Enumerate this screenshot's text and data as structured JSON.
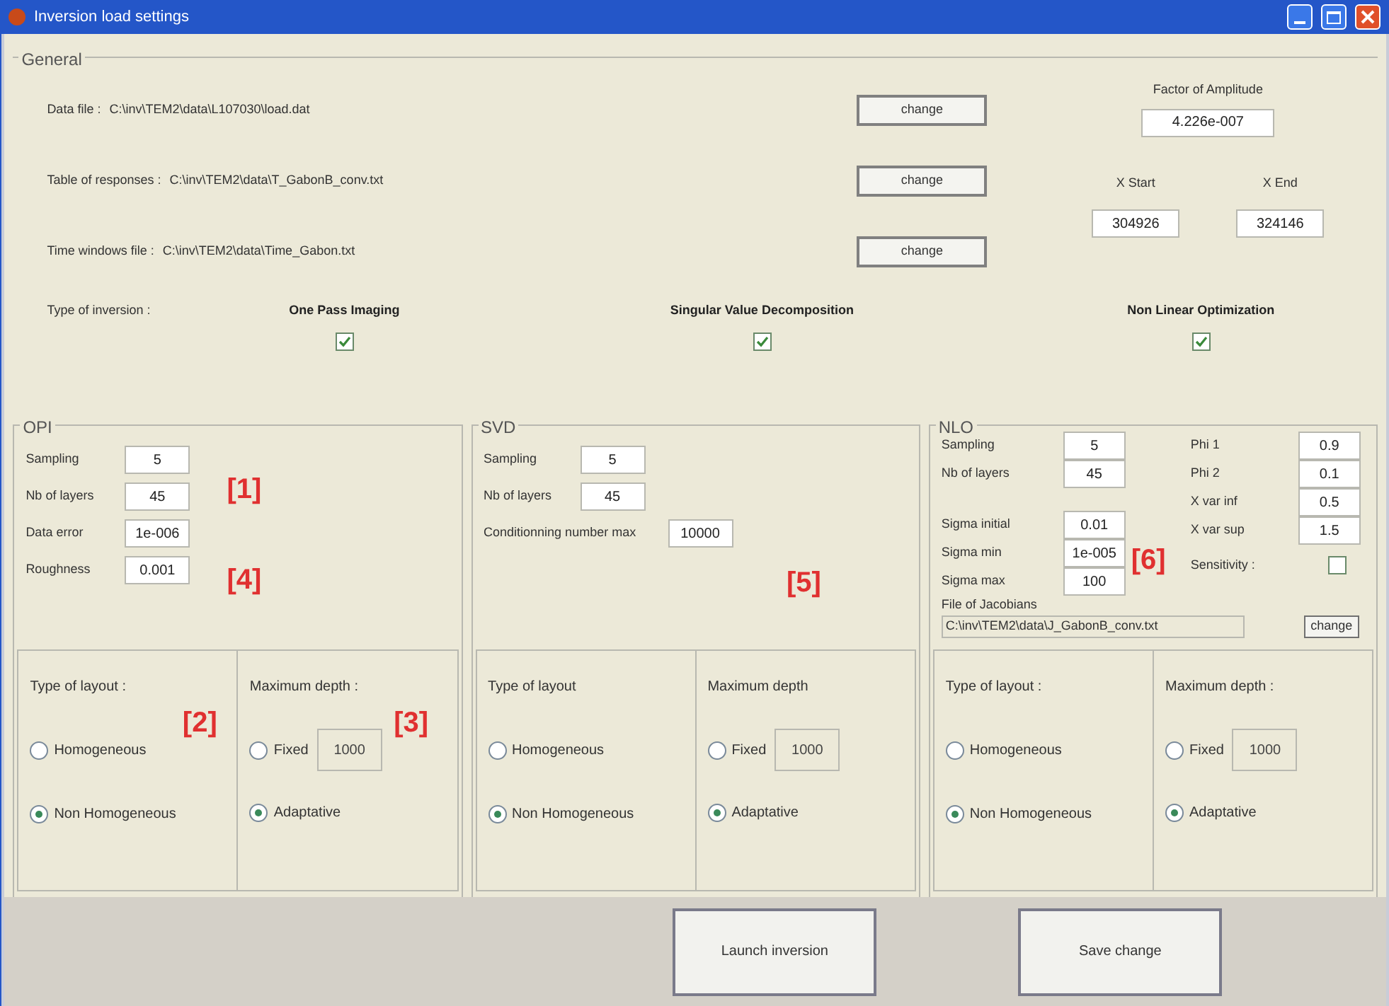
{
  "window": {
    "title": "Inversion load settings"
  },
  "general": {
    "legend": "General",
    "files": [
      {
        "label": "Data file :",
        "path": "C:\\inv\\TEM2\\data\\L107030\\load.dat",
        "button": "change"
      },
      {
        "label": "Table of responses :",
        "path": "C:\\inv\\TEM2\\data\\T_GabonB_conv.txt",
        "button": "change"
      },
      {
        "label": "Time windows file :",
        "path": "C:\\inv\\TEM2\\data\\Time_Gabon.txt",
        "button": "change"
      }
    ],
    "amplitude": {
      "label": "Factor of Amplitude",
      "value": "4.226e-007"
    },
    "x_start": {
      "label": "X Start",
      "value": "304926"
    },
    "x_end": {
      "label": "X End",
      "value": "324146"
    },
    "inversion_type": {
      "label": "Type of inversion :",
      "options": [
        {
          "label": "One Pass Imaging",
          "checked": true
        },
        {
          "label": "Singular Value Decomposition",
          "checked": true
        },
        {
          "label": "Non Linear Optimization",
          "checked": true
        }
      ]
    }
  },
  "panels": [
    {
      "kind": "opi",
      "legend": "OPI",
      "fields": [
        {
          "label": "Sampling",
          "value": "5"
        },
        {
          "label": "Nb of layers",
          "value": "45"
        },
        {
          "label": "Data error",
          "value": "1e-006"
        },
        {
          "label": "Roughness",
          "value": "0.001"
        }
      ],
      "annotations": [
        "[1]",
        "[4]"
      ],
      "layout": {
        "label": "Type of layout :",
        "annotation": "[2]",
        "options": [
          {
            "label": "Homogeneous",
            "selected": false
          },
          {
            "label": "Non Homogeneous",
            "selected": true
          }
        ]
      },
      "depth": {
        "label": "Maximum depth :",
        "annotation": "[3]",
        "fixed_value": "1000",
        "options": [
          {
            "label": "Fixed",
            "selected": false
          },
          {
            "label": "Adaptative",
            "selected": true
          }
        ]
      }
    },
    {
      "kind": "svd",
      "legend": "SVD",
      "fields": [
        {
          "label": "Sampling",
          "value": "5"
        },
        {
          "label": "Nb of layers",
          "value": "45"
        },
        {
          "label": "Conditionning number max",
          "value": "10000"
        }
      ],
      "annotations": [
        "[5]"
      ],
      "layout": {
        "label": "Type of layout",
        "options": [
          {
            "label": "Homogeneous",
            "selected": false
          },
          {
            "label": "Non Homogeneous",
            "selected": true
          }
        ]
      },
      "depth": {
        "label": "Maximum depth",
        "fixed_value": "1000",
        "options": [
          {
            "label": "Fixed",
            "selected": false
          },
          {
            "label": "Adaptative",
            "selected": true
          }
        ]
      }
    },
    {
      "kind": "nlo",
      "legend": "NLO",
      "fields": [
        {
          "label": "Sampling",
          "value": "5"
        },
        {
          "label": "Nb of layers",
          "value": "45"
        },
        {
          "label": "Sigma initial",
          "value": "0.01"
        },
        {
          "label": "Sigma min",
          "value": "1e-005"
        },
        {
          "label": "Sigma max",
          "value": "100"
        }
      ],
      "fields_right": [
        {
          "label": "Phi 1",
          "value": "0.9"
        },
        {
          "label": "Phi 2",
          "value": "0.1"
        },
        {
          "label": "X var inf",
          "value": "0.5"
        },
        {
          "label": "X var sup",
          "value": "1.5"
        }
      ],
      "sensitivity": {
        "label": "Sensitivity :",
        "checked": false
      },
      "jacobians": {
        "label": "File of Jacobians",
        "path": "C:\\inv\\TEM2\\data\\J_GabonB_conv.txt",
        "button": "change"
      },
      "annotations": [
        "[6]"
      ],
      "layout": {
        "label": "Type of layout :",
        "options": [
          {
            "label": "Homogeneous",
            "selected": false
          },
          {
            "label": "Non Homogeneous",
            "selected": true
          }
        ]
      },
      "depth": {
        "label": "Maximum depth :",
        "fixed_value": "1000",
        "options": [
          {
            "label": "Fixed",
            "selected": false
          },
          {
            "label": "Adaptative",
            "selected": true
          }
        ]
      }
    }
  ],
  "buttons": [
    "Launch inversion",
    "Save change"
  ]
}
